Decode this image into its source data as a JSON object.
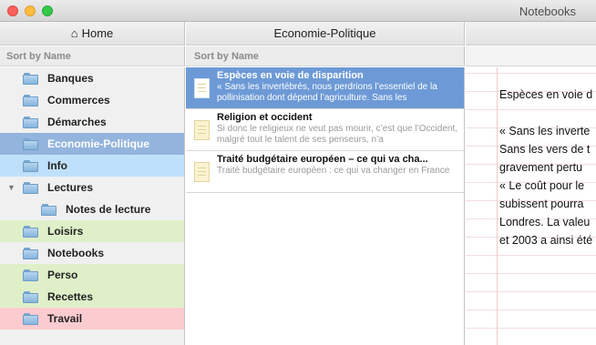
{
  "window": {
    "title": "Notebooks"
  },
  "columns": {
    "left": {
      "header_icon": "home-icon",
      "header": "Home",
      "sort_label": "Sort by Name"
    },
    "middle": {
      "header": "Economie-Politique",
      "sort_label": "Sort by Name"
    }
  },
  "sidebar": {
    "items": [
      {
        "label": "Banques",
        "bg": "#f0f0f0"
      },
      {
        "label": "Commerces",
        "bg": "#f0f0f0"
      },
      {
        "label": "Démarches",
        "bg": "#f0f0f0"
      },
      {
        "label": "Economie-Politique",
        "bg": "#93b4dd",
        "selected": true
      },
      {
        "label": "Info",
        "bg": "#bfe0fb"
      },
      {
        "label": "Lectures",
        "bg": "#f0f0f0",
        "expanded": true
      },
      {
        "label": "Notes de lecture",
        "bg": "#f0f0f0",
        "indent": true
      },
      {
        "label": "Loisirs",
        "bg": "#dff0c9"
      },
      {
        "label": "Notebooks",
        "bg": "#f0f0f0"
      },
      {
        "label": "Perso",
        "bg": "#dff0c9"
      },
      {
        "label": "Recettes",
        "bg": "#dff0c9"
      },
      {
        "label": "Travail",
        "bg": "#fbcbd0"
      }
    ]
  },
  "notes": [
    {
      "title": "Espèces en voie de disparition",
      "snippet": "« Sans les invertébrés, nous perdrions l’essentiel de la pollinisation dont dépend l’agriculture. Sans les",
      "selected": true
    },
    {
      "title": "Religion et occident",
      "snippet": "Si donc le religieux ne veut pas mourir, c’est que l’Occident, malgré tout le talent de ses penseurs, n’a",
      "selected": false
    },
    {
      "title": "Traité budgétaire européen – ce qui va cha...",
      "snippet": "Traité budgétaire européen : ce qui va changer en France",
      "selected": false
    }
  ],
  "editor": {
    "lines": [
      "Espèces en voie d",
      "",
      "« Sans les inverte",
      "Sans les vers de t",
      "gravement pertu",
      "« Le coût pour le",
      "subissent pourra",
      "Londres. La valeu",
      "et 2003 a ainsi été"
    ]
  }
}
